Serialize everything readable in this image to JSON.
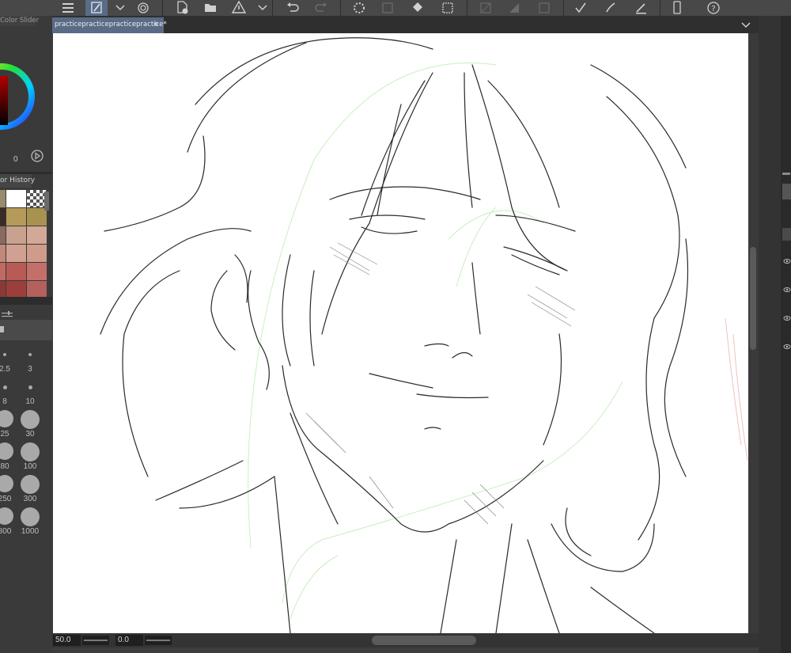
{
  "document": {
    "tab_title": "practicepracticepracticepractice*",
    "close_dot": "●"
  },
  "left_panel": {
    "color_slider_label": "Color Slider",
    "color_value": "0",
    "color_history_label": "or History",
    "history_colors": [
      [
        "#9a8a6e",
        "#ffffff",
        "checker"
      ],
      [
        "#3b2c28",
        "#b59a5a",
        "#a8924f"
      ],
      [
        "#8a6a5e",
        "#c9a28f",
        "#d2a996"
      ],
      [
        "#c08a7a",
        "#d0a192",
        "#cf9c8c"
      ],
      [
        "#c06a64",
        "#b85a56",
        "#c4706a"
      ],
      [
        "#8a3a36",
        "#9c3f3c",
        "#b4605c"
      ]
    ],
    "brush_sizes": [
      "2.5",
      "3",
      "8",
      "10",
      "25",
      "30",
      "80",
      "100",
      "250",
      "300",
      "800",
      "1000"
    ]
  },
  "status_bar": {
    "zoom_value": "50.0",
    "angle_value": "0.0"
  },
  "colors": {
    "accent_tab": "#5a6b86",
    "toolbar_bg": "#484848",
    "canvas_bg": "#ffffff"
  },
  "icons": {
    "menu": "menu-icon",
    "edit": "pen-edit-icon",
    "dropdown": "chevron-down-icon",
    "spiral": "spiral-icon",
    "new-file": "new-file-icon",
    "open-folder": "folder-open-icon",
    "warning": "warning-icon",
    "undo": "undo-icon",
    "redo": "redo-icon",
    "loading": "loading-icon",
    "fill": "fill-bucket-icon",
    "select": "selection-icon",
    "help": "help-icon"
  }
}
